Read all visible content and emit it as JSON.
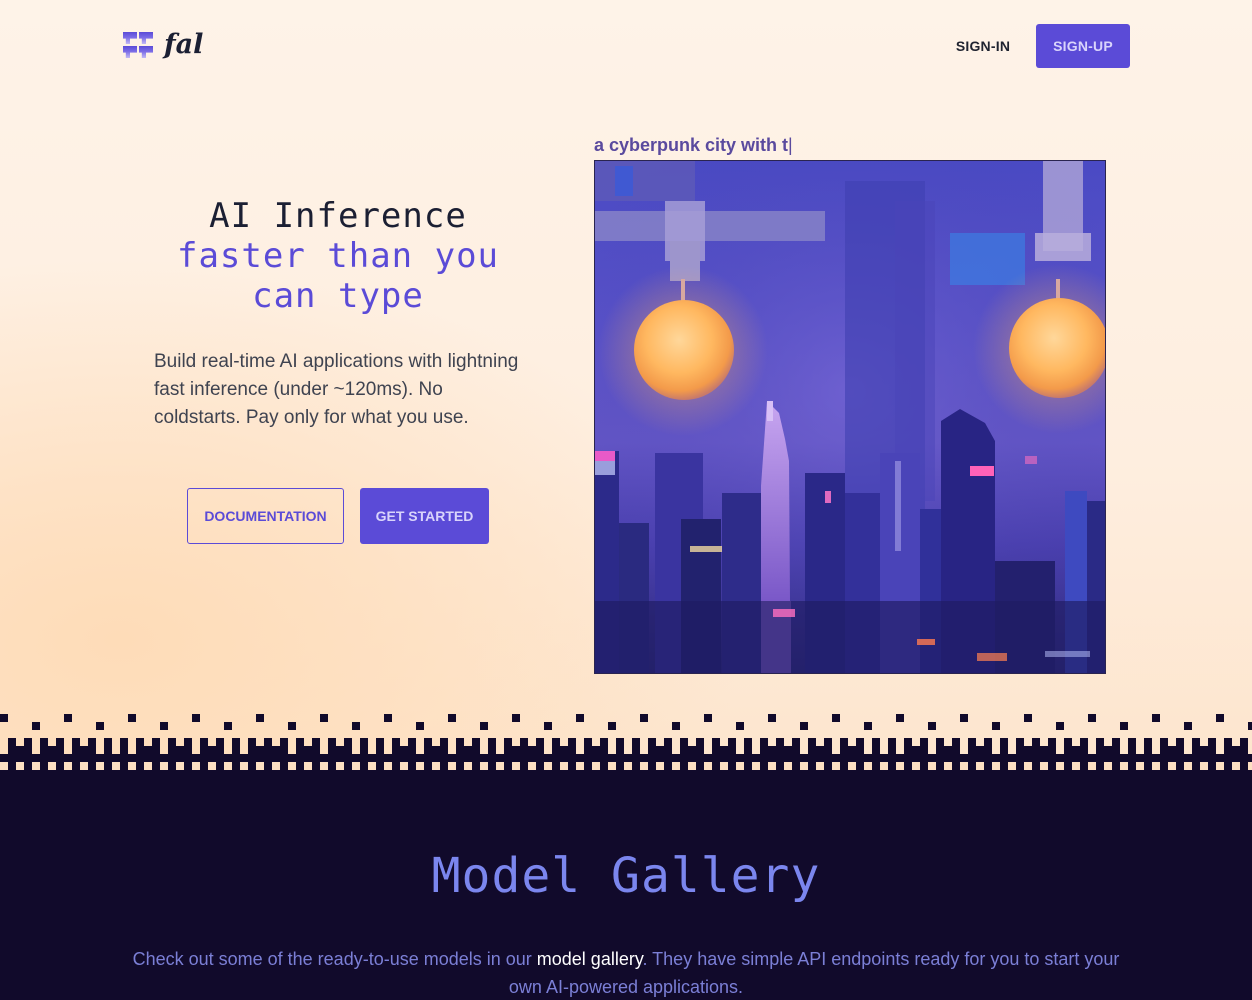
{
  "nav": {
    "logo_text": "fal",
    "sign_in_label": "SIGN-IN",
    "sign_up_label": "SIGN-UP"
  },
  "hero": {
    "headline_line1": "AI Inference",
    "headline_line2": "faster than you",
    "headline_line3": "can type",
    "subtitle": "Build real-time AI applications with lightning fast inference (under ~120ms). No coldstarts. Pay only for what you use.",
    "documentation_label": "DOCUMENTATION",
    "get_started_label": "GET STARTED",
    "prompt_text": "a cyberpunk city with t",
    "prompt_caret": "|",
    "image_alt": "Generated image of a cyberpunk city at night with glowing orange lamps"
  },
  "gallery": {
    "title": "Model Gallery",
    "text_before": "Check out some of the ready-to-use models in our ",
    "link_text": "model gallery",
    "text_after": ". They have simple API endpoints ready for you to start your own AI-powered applications."
  },
  "colors": {
    "accent": "#5b4bd7",
    "dark_bg": "#110a2b",
    "hero_bg": "#fef2e6",
    "gallery_title": "#7b86ee",
    "gallery_text": "#7b7fd6"
  }
}
